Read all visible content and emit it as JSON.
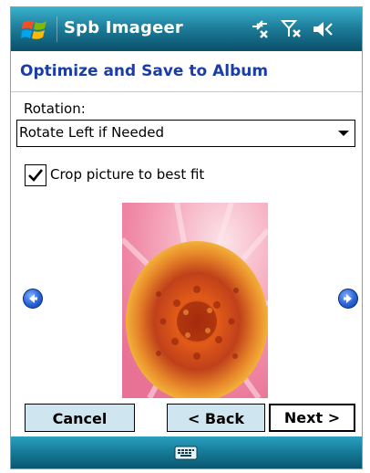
{
  "titlebar": {
    "app_title": "Spb Imageer",
    "icons": [
      "windows-start-icon",
      "connectivity-icon",
      "signal-off-icon",
      "speaker-mute-icon"
    ]
  },
  "page": {
    "heading": "Optimize and Save to Album"
  },
  "rotation": {
    "label": "Rotation:",
    "selected": "Rotate Left if Needed"
  },
  "crop": {
    "label": "Crop picture to best fit",
    "checked": true
  },
  "buttons": {
    "cancel": "Cancel",
    "back": "< Back",
    "next": "Next >"
  },
  "colors": {
    "titlebar": "#1e7f9c",
    "heading": "#1a3da8",
    "button_bg": "#cfe6f0",
    "nav_arrow": "#2a62d6"
  },
  "icons": {
    "prev": "arrow-left-circle-icon",
    "next": "arrow-right-circle-icon",
    "keyboard": "keyboard-icon"
  }
}
